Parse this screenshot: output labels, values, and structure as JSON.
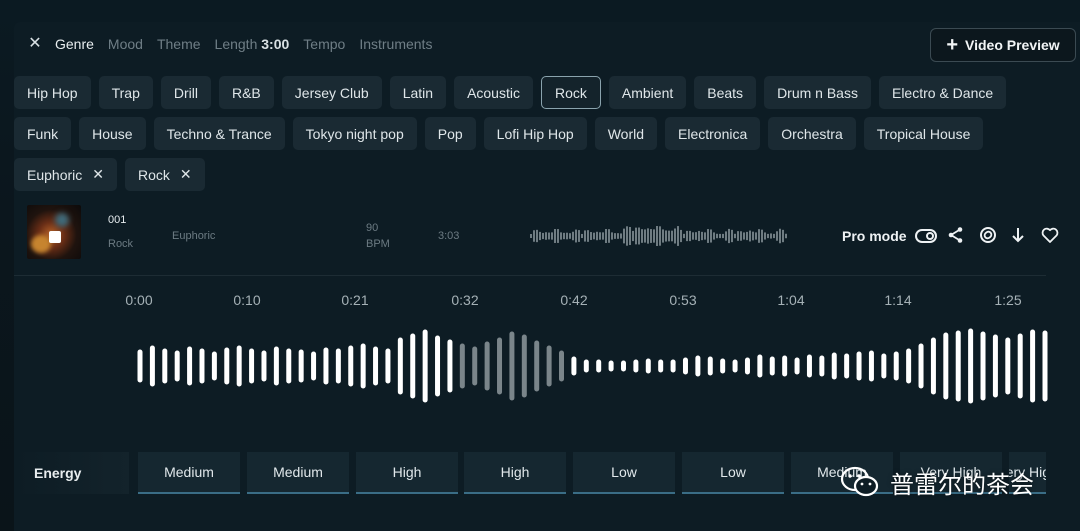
{
  "filters": {
    "tabs": [
      {
        "label": "Genre",
        "active": true
      },
      {
        "label": "Mood"
      },
      {
        "label": "Theme"
      },
      {
        "label": "Length",
        "value": "3:00"
      },
      {
        "label": "Tempo"
      },
      {
        "label": "Instruments"
      }
    ],
    "video_preview_label": "Video Preview"
  },
  "genres_row1": [
    "Hip Hop",
    "Trap",
    "Drill",
    "R&B",
    "Jersey Club",
    "Latin",
    "Acoustic",
    "Rock",
    "Ambient",
    "Beats",
    "Drum n Bass",
    "Electro & Dance"
  ],
  "genres_row2": [
    "Funk",
    "House",
    "Techno & Trance",
    "Tokyo night pop",
    "Pop",
    "Lofi Hip Hop",
    "World",
    "Electronica",
    "Orchestra",
    "Tropical House"
  ],
  "selected_genre": "Rock",
  "active_filters": [
    "Euphoric",
    "Rock"
  ],
  "track": {
    "id": "001",
    "genre": "Rock",
    "mood": "Euphoric",
    "bpm_value": "90",
    "bpm_unit": "BPM",
    "length": "3:03",
    "pro_mode_label": "Pro mode"
  },
  "timeline": [
    "0:00",
    "0:10",
    "0:21",
    "0:32",
    "0:42",
    "0:53",
    "1:04",
    "1:14",
    "1:25"
  ],
  "energy": {
    "label": "Energy",
    "segments": [
      "Medium",
      "Medium",
      "High",
      "High",
      "Low",
      "Low",
      "Medium",
      "Very High",
      "Very High"
    ]
  },
  "watermark": "普雷尔的茶会",
  "colors": {
    "accent_underline": "#3a6d86",
    "chip_bg": "#1a2a33",
    "panel_bg": "#0d1c24"
  }
}
